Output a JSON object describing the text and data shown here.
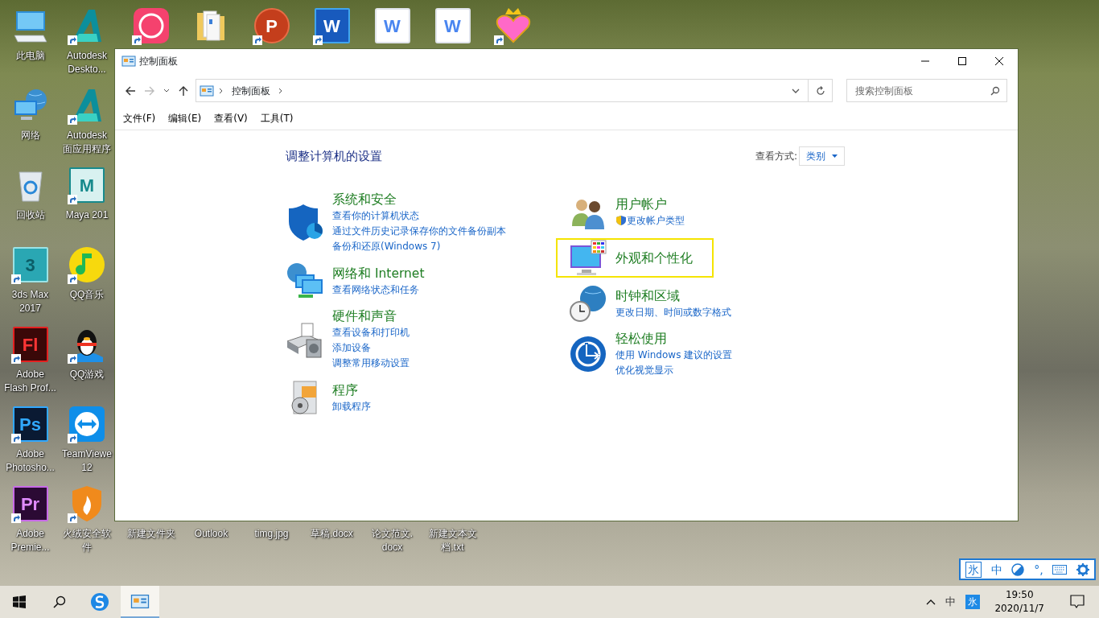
{
  "desktop": {
    "left_columns": [
      [
        {
          "kind": "pc",
          "label": "此电脑",
          "shortcut": false
        },
        {
          "kind": "network",
          "label": "网络",
          "shortcut": false
        },
        {
          "kind": "recycle",
          "label": "回收站",
          "shortcut": false
        },
        {
          "kind": "max",
          "glyph": "3",
          "label": "3ds Max\n2017",
          "shortcut": true
        },
        {
          "kind": "flash",
          "glyph": "Fl",
          "label": "Adobe\nFlash Prof...",
          "shortcut": true
        },
        {
          "kind": "photoshop",
          "glyph": "Ps",
          "label": "Adobe\nPhotosho...",
          "shortcut": true
        },
        {
          "kind": "premiere",
          "glyph": "Pr",
          "label": "Adobe\nPremie...",
          "shortcut": true
        }
      ],
      [
        {
          "kind": "autodesk",
          "label": "Autodesk\nDeskto...",
          "shortcut": true
        },
        {
          "kind": "autodesk",
          "label": "Autodesk\n面应用程序",
          "shortcut": true
        },
        {
          "kind": "maya",
          "glyph": "M",
          "label": "Maya 201",
          "shortcut": true
        },
        {
          "kind": "qqmusic",
          "label": "QQ音乐",
          "shortcut": true
        },
        {
          "kind": "qq",
          "label": "QQ游戏",
          "shortcut": true
        },
        {
          "kind": "teamviewer",
          "label": "TeamViewe\n12",
          "shortcut": true
        },
        {
          "kind": "huorong",
          "label": "火绒安全软件",
          "shortcut": true
        }
      ]
    ],
    "top_row": [
      {
        "kind": "meitu",
        "shortcut": true
      },
      {
        "kind": "folder",
        "shortcut": false
      },
      {
        "kind": "powerpoint",
        "glyph": "P",
        "shortcut": true
      },
      {
        "kind": "word",
        "glyph": "W",
        "shortcut": true
      },
      {
        "kind": "wps-doc",
        "glyph": "W",
        "shortcut": false
      },
      {
        "kind": "wps-doc",
        "glyph": "W",
        "shortcut": false
      },
      {
        "kind": "heart",
        "shortcut": true
      }
    ],
    "bottom_row_labels": [
      "新建文件夹",
      "Outlook",
      "timg.jpg",
      "草稿.docx",
      "论文范文.\ndocx",
      "新建文本文档.txt"
    ]
  },
  "window": {
    "title": "控制面板",
    "back": {
      "disabled": false
    },
    "forward": {
      "disabled": true
    },
    "address": [
      "控制面板"
    ],
    "search": {
      "placeholder": "搜索控制面板"
    },
    "menu": [
      "文件(F)",
      "编辑(E)",
      "查看(V)",
      "工具(T)"
    ],
    "heading": "调整计算机的设置",
    "view_by": {
      "label": "查看方式:",
      "value": "类别"
    },
    "left_categories": [
      {
        "kind": "security",
        "title": "系统和安全",
        "highlighted": false,
        "links": [
          {
            "text": "查看你的计算机状态",
            "shield": false
          },
          {
            "text": "通过文件历史记录保存你的文件备份副本",
            "shield": false
          },
          {
            "text": "备份和还原(Windows 7)",
            "shield": false
          }
        ]
      },
      {
        "kind": "network",
        "title": "网络和 Internet",
        "highlighted": false,
        "links": [
          {
            "text": "查看网络状态和任务",
            "shield": false
          }
        ]
      },
      {
        "kind": "hardware",
        "title": "硬件和声音",
        "highlighted": false,
        "links": [
          {
            "text": "查看设备和打印机",
            "shield": false
          },
          {
            "text": "添加设备",
            "shield": false
          },
          {
            "text": "调整常用移动设置",
            "shield": false
          }
        ]
      },
      {
        "kind": "programs",
        "title": "程序",
        "highlighted": false,
        "links": [
          {
            "text": "卸载程序",
            "shield": false
          }
        ]
      }
    ],
    "right_categories": [
      {
        "kind": "users",
        "title": "用户帐户",
        "highlighted": false,
        "links": [
          {
            "text": "更改帐户类型",
            "shield": true
          }
        ]
      },
      {
        "kind": "appearance",
        "title": "外观和个性化",
        "highlighted": true
      },
      {
        "kind": "clock",
        "title": "时钟和区域",
        "highlighted": false,
        "links": [
          {
            "text": "更改日期、时间或数字格式",
            "shield": false
          }
        ]
      },
      {
        "kind": "ease",
        "title": "轻松使用",
        "highlighted": false,
        "links": [
          {
            "text": "使用 Windows 建议的设置",
            "shield": false
          },
          {
            "text": "优化视觉显示",
            "shield": false
          }
        ]
      }
    ]
  },
  "ime_toolbar": {
    "logo": "氷",
    "mode": "中",
    "punctuation": "°,"
  },
  "taskbar": {
    "apps": [
      {
        "kind": "start",
        "selected": false
      },
      {
        "kind": "search",
        "selected": false
      },
      {
        "kind": "browser",
        "selected": false
      },
      {
        "kind": "control-panel",
        "selected": true
      }
    ],
    "tray": {
      "ime_mode": "中",
      "ime_logo": "氷",
      "time": "19:50",
      "date": "2020/11/7"
    }
  }
}
